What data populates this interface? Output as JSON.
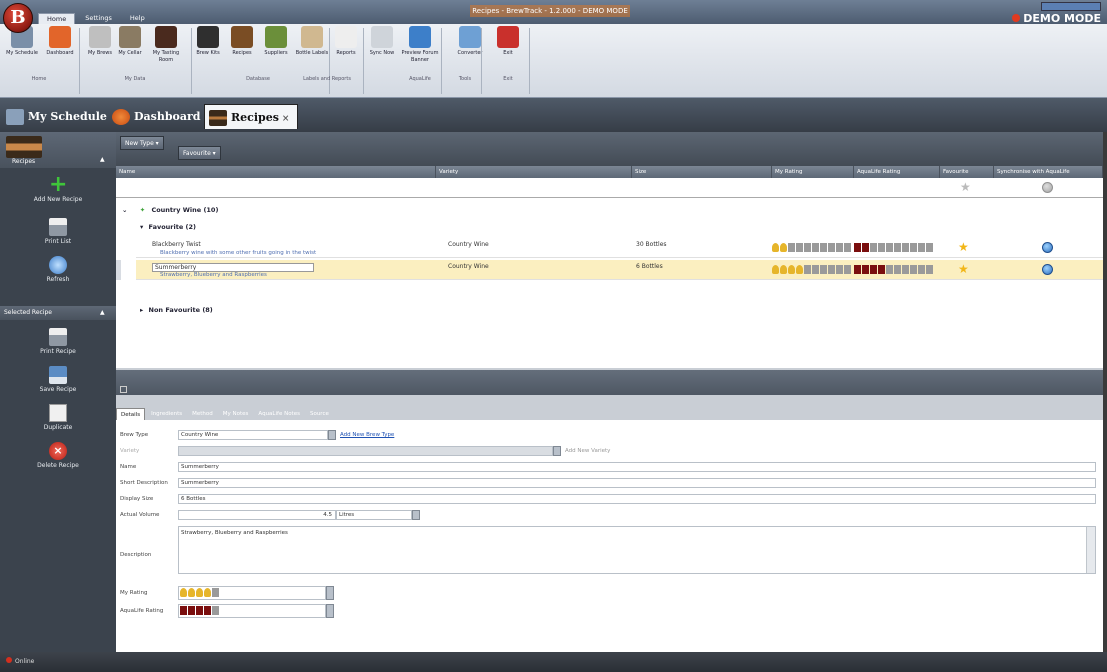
{
  "window": {
    "title": "Recipes - BrewTrack - 1.2.000 - DEMO MODE",
    "demo_mode": "DEMO MODE",
    "app_orb": "B"
  },
  "menu": [
    "Home",
    "Settings",
    "Help"
  ],
  "ribbon": {
    "buttons": [
      {
        "label": "My Schedule",
        "icon": "calendar-icon",
        "color": "#7a8fa8"
      },
      {
        "label": "Dashboard",
        "icon": "dashboard-icon",
        "color": "#e2652a"
      },
      {
        "label": "My Brews",
        "icon": "bottle-icon",
        "color": "#bfbfbf"
      },
      {
        "label": "My Cellar",
        "icon": "cellar-icon",
        "color": "#8a7b63"
      },
      {
        "label": "My Tasting Room",
        "icon": "glass-icon",
        "color": "#4a2a1e"
      },
      {
        "label": "Brew Kits",
        "icon": "kit-icon",
        "color": "#2f2f2f"
      },
      {
        "label": "Recipes",
        "icon": "recipe-icon",
        "color": "#7a4d24"
      },
      {
        "label": "Suppliers",
        "icon": "suppliers-icon",
        "color": "#6b8f3a"
      },
      {
        "label": "Bottle Labels",
        "icon": "label-icon",
        "color": "#d0b890"
      },
      {
        "label": "Reports",
        "icon": "report-icon",
        "color": "#eeeeee"
      },
      {
        "label": "Sync Now",
        "icon": "sync-icon",
        "color": "#cfd4da"
      },
      {
        "label": "Preview Forum Banner",
        "icon": "globe-icon",
        "color": "#3d7fc9"
      },
      {
        "label": "Converter",
        "icon": "converter-icon",
        "color": "#6ea0d4"
      },
      {
        "label": "Exit",
        "icon": "exit-icon",
        "color": "#c9302c"
      }
    ],
    "groups": [
      "Home",
      "My Data",
      "Database",
      "Labels and Reports",
      "AquaLife",
      "Tools",
      "Exit"
    ]
  },
  "doc_tabs": [
    {
      "label": "My Schedule",
      "icon": "calendar-icon"
    },
    {
      "label": "Dashboard",
      "icon": "dashboard-icon"
    },
    {
      "label": "Recipes",
      "icon": "recipe-icon",
      "close": "×"
    }
  ],
  "leftnav": {
    "section1": "Recipes",
    "items1": [
      {
        "label": "Add New Recipe",
        "icon": "plus-icon"
      },
      {
        "label": "Print List",
        "icon": "print-icon"
      },
      {
        "label": "Refresh",
        "icon": "refresh-icon"
      }
    ],
    "section2": "Selected Recipe",
    "items2": [
      {
        "label": "Print Recipe",
        "icon": "print-icon"
      },
      {
        "label": "Save Recipe",
        "icon": "save-icon"
      },
      {
        "label": "Duplicate",
        "icon": "duplicate-icon"
      },
      {
        "label": "Delete Recipe",
        "icon": "delete-icon"
      }
    ]
  },
  "grid": {
    "toolbar": {
      "new_type": "New Type ▾",
      "favourite": "Favourite ▾"
    },
    "columns": [
      "Name",
      "Variety",
      "Size",
      "My Rating",
      "AquaLife Rating",
      "Favourite",
      "Synchronise with AquaLife"
    ],
    "group_top": "Country Wine (10)",
    "group_fav": "Favourite (2)",
    "group_nonfav": "Non Favourite (8)",
    "rows": [
      {
        "name": "Blackberry Twist",
        "description": "Blackberry wine with some other fruits going in the twist",
        "variety": "Country Wine",
        "size": "30 Bottles",
        "my_rating": 2,
        "aqua_rating": 2
      },
      {
        "name": "Summerberry",
        "description": "Strawberry, Blueberry and Raspberries",
        "variety": "Country Wine",
        "size": "6 Bottles",
        "my_rating": 4,
        "aqua_rating": 4
      }
    ]
  },
  "detail": {
    "tabs": [
      "Details",
      "Ingredients",
      "Method",
      "My Notes",
      "AquaLife Notes",
      "Source"
    ],
    "fields": {
      "brew_type_label": "Brew Type",
      "brew_type": "Country Wine",
      "add_brew_type": "Add New Brew Type",
      "variety_label": "Variety",
      "add_variety": "Add New Variety",
      "name_label": "Name",
      "name": "Summerberry",
      "short_desc_label": "Short Description",
      "short_desc": "Summerberry",
      "display_size_label": "Display Size",
      "display_size": "6 Bottles",
      "actual_volume_label": "Actual Volume",
      "actual_volume": "4.5",
      "volume_unit": "Litres",
      "description_label": "Description",
      "description": "Strawberry, Blueberry and Raspberries",
      "my_rating_label": "My Rating",
      "my_rating": 4,
      "aqua_rating_label": "AquaLife Rating",
      "aqua_rating": 4
    }
  },
  "status": "Online",
  "colors": {
    "rating_pin": "#e6b52a",
    "rating_dark": "#7a0e0e",
    "rating_empty": "#9a9a9a",
    "favourite_star": "#f2b617"
  }
}
